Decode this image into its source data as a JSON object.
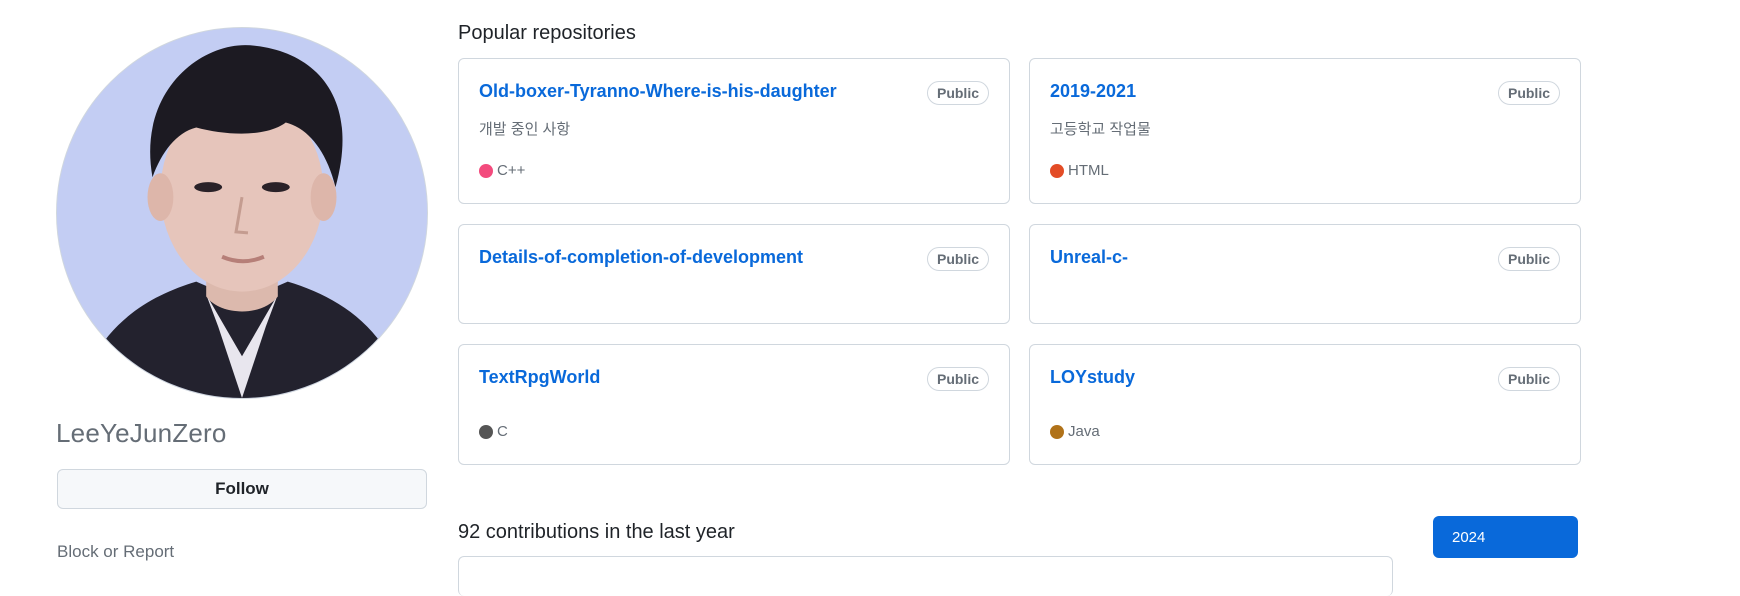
{
  "profile": {
    "username": "LeeYeJunZero",
    "follow_label": "Follow",
    "block_label": "Block or Report"
  },
  "popular": {
    "title": "Popular repositories",
    "repos": [
      {
        "name": "Old-boxer-Tyranno-Where-is-his-daughter",
        "visibility": "Public",
        "description": "개발 중인 사항",
        "language": "C++",
        "language_color": "#f34b7d"
      },
      {
        "name": "2019-2021",
        "visibility": "Public",
        "description": "고등학교 작업물",
        "language": "HTML",
        "language_color": "#e34c26"
      },
      {
        "name": "Details-of-completion-of-development",
        "visibility": "Public",
        "description": "",
        "language": "",
        "language_color": ""
      },
      {
        "name": "Unreal-c-",
        "visibility": "Public",
        "description": "",
        "language": "",
        "language_color": ""
      },
      {
        "name": "TextRpgWorld",
        "visibility": "Public",
        "description": "",
        "language": "C",
        "language_color": "#555555"
      },
      {
        "name": "LOYstudy",
        "visibility": "Public",
        "description": "",
        "language": "Java",
        "language_color": "#b07219"
      }
    ]
  },
  "contributions": {
    "title": "92 contributions in the last year",
    "selected_year": "2024"
  },
  "colors": {
    "link": "#0969da",
    "muted": "#656d76",
    "border": "#d0d7de"
  }
}
